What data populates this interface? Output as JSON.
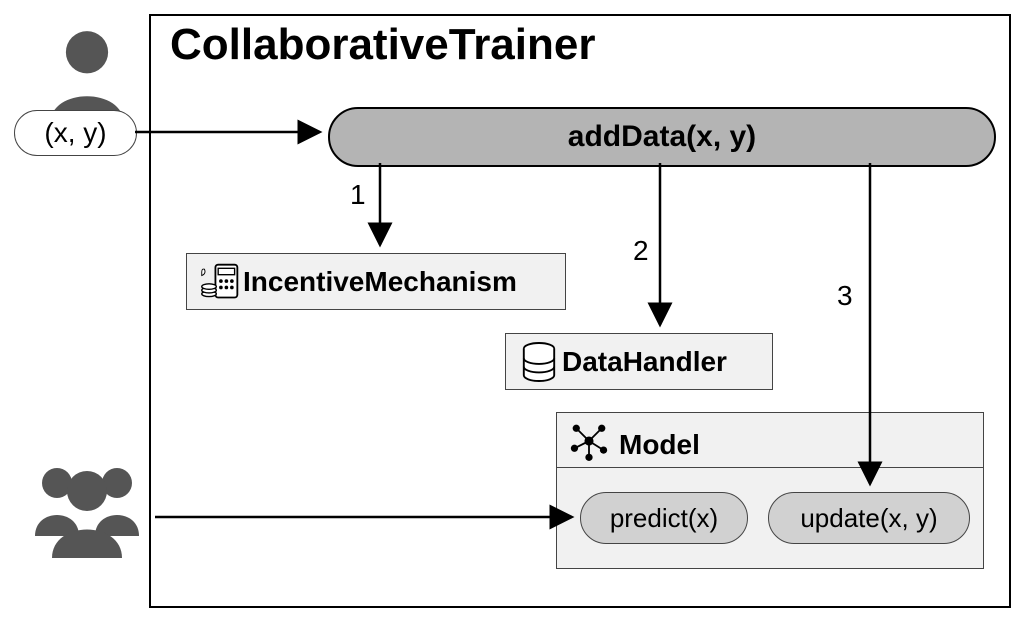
{
  "title": "CollaborativeTrainer",
  "user_data": "(x, y)",
  "addData": "addData(x, y)",
  "steps": {
    "s1": "1",
    "s2": "2",
    "s3": "3"
  },
  "components": {
    "incentive": "IncentiveMechanism",
    "datahandler": "DataHandler",
    "model": "Model"
  },
  "model_methods": {
    "predict": "predict(x)",
    "update": "update(x, y)"
  },
  "icons": {
    "user": "user-icon",
    "users": "users-icon",
    "money_calc": "money-calc-icon",
    "database": "database-icon",
    "network": "network-icon"
  }
}
